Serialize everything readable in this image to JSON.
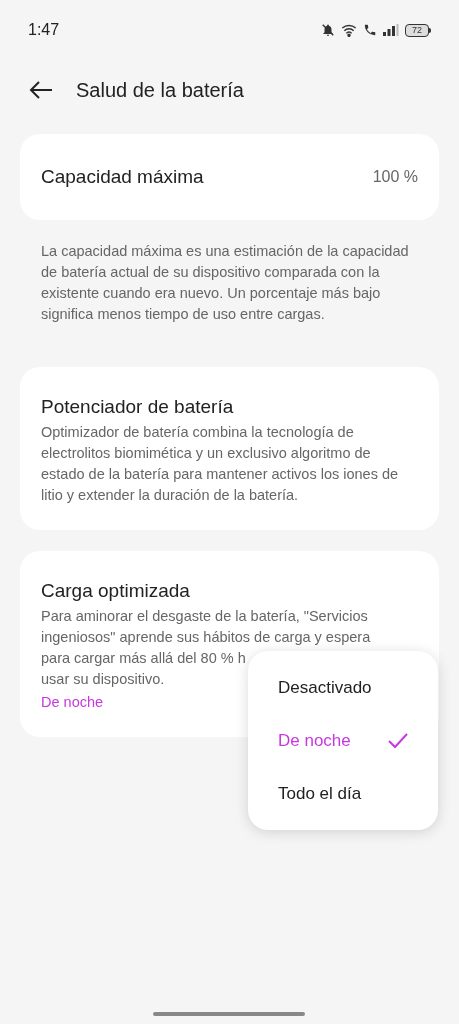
{
  "status_bar": {
    "time": "1:47",
    "battery": "72"
  },
  "header": {
    "title": "Salud de la batería"
  },
  "capacity": {
    "label": "Capacidad máxima",
    "value": "100 %",
    "description": "La capacidad máxima es una estimación de la capacidad de batería actual de su dispositivo comparada con la existente cuando era nuevo. Un porcentaje más bajo significa menos tiempo de uso entre cargas."
  },
  "booster": {
    "title": "Potenciador de batería",
    "description": "Optimizador de batería combina la tecnología de electrolitos biomimética y un exclusivo algoritmo de estado de la batería para mantener activos los iones de litio y extender la duración de la batería."
  },
  "optimized_charging": {
    "title": "Carga optimizada",
    "description_lines": [
      "Para aminorar el desgaste de la batería, \"Servicios",
      "ingeniosos\" aprende sus hábitos de carga y espera",
      "para cargar más allá del 80 % h",
      "usar su dispositivo."
    ],
    "current": "De noche"
  },
  "menu": {
    "options": [
      {
        "label": "Desactivado",
        "selected": false
      },
      {
        "label": "De noche",
        "selected": true
      },
      {
        "label": "Todo el día",
        "selected": false
      }
    ]
  }
}
